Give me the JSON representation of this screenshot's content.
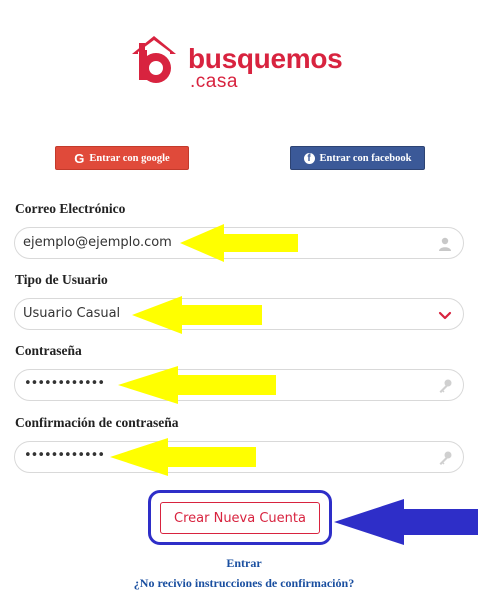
{
  "brand": {
    "name": "busquemos",
    "sub": ".casa",
    "color": "#d8233f"
  },
  "social": {
    "google_label": "Entrar con google",
    "google_icon": "G",
    "facebook_label": "Entrar con facebook",
    "facebook_icon": "f"
  },
  "form": {
    "email": {
      "label": "Correo Electrónico",
      "value": "ejemplo@ejemplo.com",
      "icon": "user-icon"
    },
    "user_type": {
      "label": "Tipo de Usuario",
      "value": "Usuario Casual",
      "icon": "chevron-down-icon"
    },
    "password": {
      "label": "Contraseña",
      "value": "••••••••••••",
      "icon": "key-icon"
    },
    "password_confirm": {
      "label": "Confirmación de contraseña",
      "value": "••••••••••••",
      "icon": "key-icon"
    }
  },
  "actions": {
    "create_label": "Crear Nueva Cuenta",
    "login_link": "Entrar",
    "resend_link": "¿No recivio instrucciones de confirmación?"
  },
  "annotations": {
    "arrow_color": "#ffff00",
    "highlight_color": "#2e2ec8"
  }
}
